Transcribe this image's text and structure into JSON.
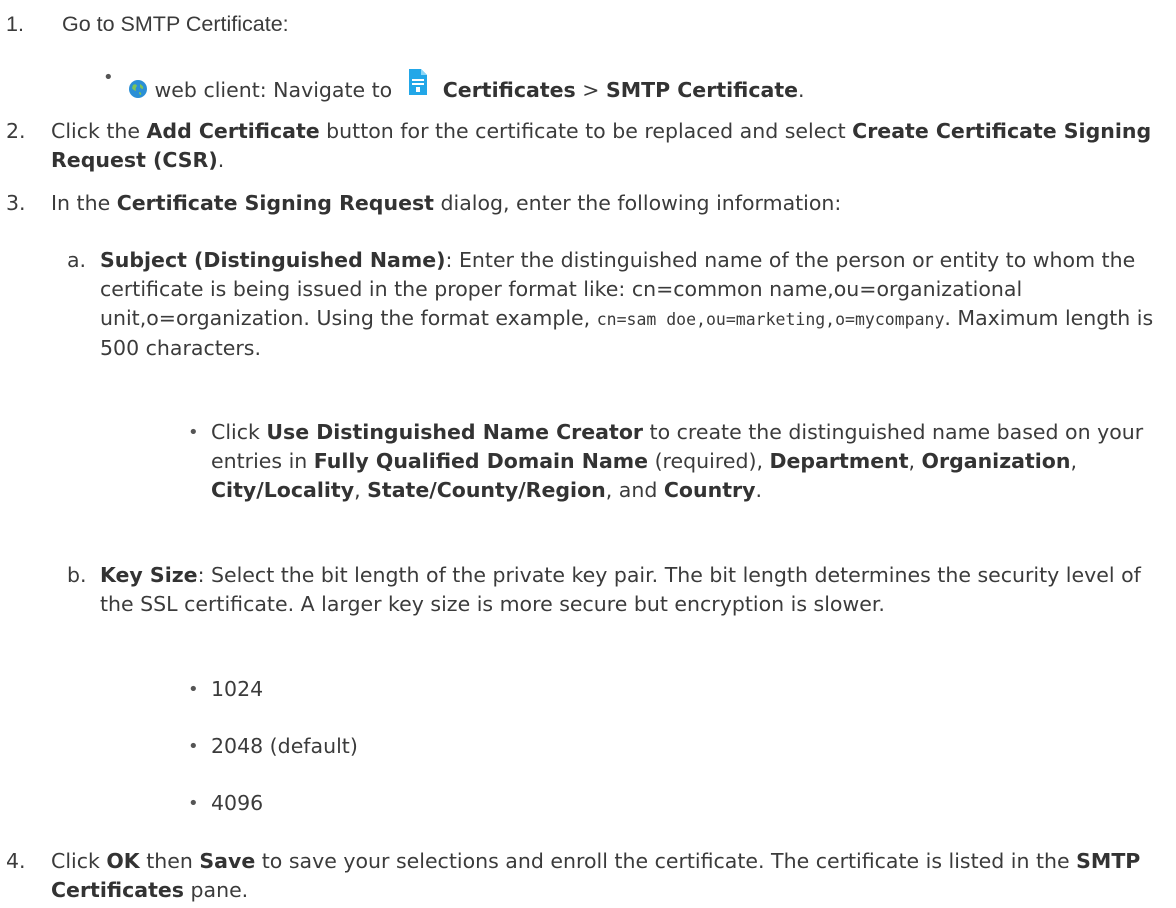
{
  "steps": [
    {
      "num": "1.",
      "text": "Go to SMTP Certificate:"
    },
    {
      "num": "2.",
      "pre": "Click the ",
      "b1": "Add Certificate",
      "mid": " button for the certificate to be replaced and select ",
      "b2": "Create Certificate Signing Request (CSR)",
      "post": "."
    },
    {
      "num": "3.",
      "pre": "In the ",
      "b1": "Certificate Signing Request",
      "post": " dialog, enter the following information:"
    },
    {
      "num": "4.",
      "pre": "Click ",
      "b1": "OK",
      "mid": " then ",
      "b2": "Save",
      "mid2": " to save your selections and enroll the certificate. The certificate is listed in the ",
      "b3": "SMTP Certificates",
      "post": " pane."
    }
  ],
  "nav": {
    "client": "web client: Navigate to",
    "b1": "Certificates",
    "sep": " > ",
    "b2": "SMTP Certificate",
    "end": ".",
    "bullet": "•",
    "globe_icon": "globe-icon",
    "cert_icon": "certificate-icon"
  },
  "sub_a": {
    "label": "a.",
    "b1": "Subject (Distinguished Name)",
    "t1": ": Enter the distinguished name of the person or entity to whom the certificate is being issued in the proper format like: cn=common name,ou=organizational unit,o=organization. Using the format example, ",
    "code": "cn=sam doe,ou=marketing,o=mycompany",
    "t2": ". Maximum length is 500 characters."
  },
  "sub_a_bullet": {
    "bullet": "•",
    "pre": "Click ",
    "b1": "Use Distinguished Name Creator",
    "t1": " to create the distinguished name based on your entries in ",
    "b2": "Fully Qualified Domain Name",
    "t2": " (required), ",
    "b3": "Department",
    "t3": ", ",
    "b4": "Organization",
    "t4": ", ",
    "b5": "City/Locality",
    "t5": ", ",
    "b6": "State/County/Region",
    "t6": ", and ",
    "b7": "Country",
    "t7": "."
  },
  "sub_b": {
    "label": "b.",
    "b1": "Key Size",
    "t1": ": Select the bit length of the private key pair. The bit length determines the security level of the SSL certificate. A larger key size is more secure but encryption is slower.",
    "options": [
      "1024",
      "2048 (default)",
      "4096"
    ],
    "bullet": "•"
  },
  "colors": {
    "text": "#3b3b3b",
    "globe": "#2a8fd6",
    "cert": "#22a7e8"
  }
}
